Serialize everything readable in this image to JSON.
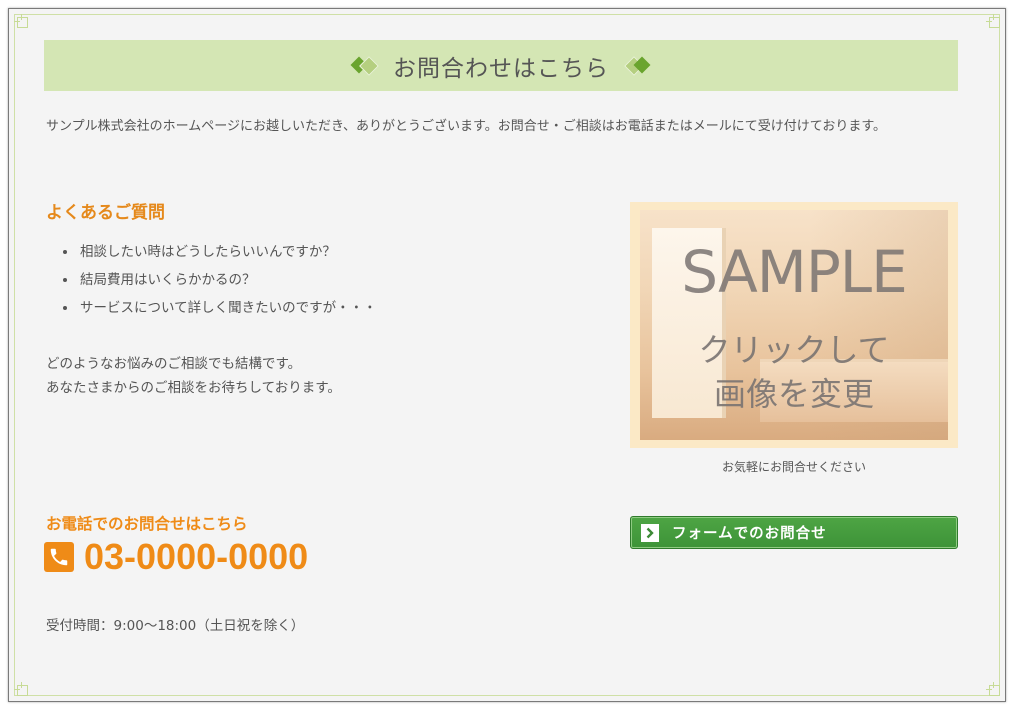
{
  "heading": {
    "title": "お問合わせはこちら"
  },
  "intro": {
    "text": "サンプル株式会社のホームページにお越しいただき、ありがとうございます。お問合せ・ご相談はお電話またはメールにて受け付けております。"
  },
  "faq": {
    "title": "よくあるご質問",
    "items": [
      "相談したい時はどうしたらいいんですか？",
      "結局費用はいくらかかるの？",
      "サービスについて詳しく聞きたいのですが・・・"
    ]
  },
  "note": {
    "line1": "どのようなお悩みのご相談でも結構です。",
    "line2": "あなたさまからのご相談をお待ちしております。"
  },
  "image": {
    "word": "SAMPLE",
    "line1": "クリックして",
    "line2": "画像を変更",
    "caption": "お気軽にお問合せください"
  },
  "phone": {
    "title": "お電話でのお問合せはこちら",
    "number": "03-0000-0000",
    "hours": "受付時間：9:00〜18:00（土日祝を除く）",
    "icon": "phone-icon"
  },
  "form_button": {
    "label": "フォームでのお問合せ",
    "icon": "chevron-right-icon"
  },
  "colors": {
    "accent_orange": "#ef8b17",
    "heading_bg": "#d4e6b4",
    "button_green": "#4ea544",
    "frame_green": "#cfe0a6"
  }
}
